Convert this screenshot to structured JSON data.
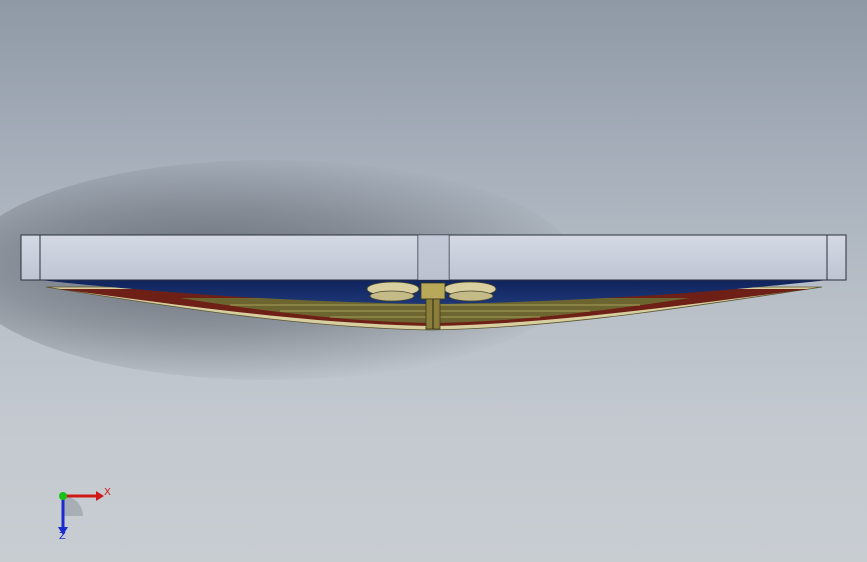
{
  "viewport": {
    "background_top": "#8f99a6",
    "background_bottom": "#c8cdd2"
  },
  "model": {
    "top_plate_color": "#c6ccd8",
    "blue_layer_color": "#142a66",
    "red_layer_color": "#6e1f16",
    "olive_layer_color": "#6d6530",
    "tan_edge_color": "#d8cfa0"
  },
  "triad": {
    "x_label": "X",
    "z_label": "Z",
    "x_color": "#d01818",
    "y_color": "#18c018",
    "z_color": "#1a2ccf"
  }
}
